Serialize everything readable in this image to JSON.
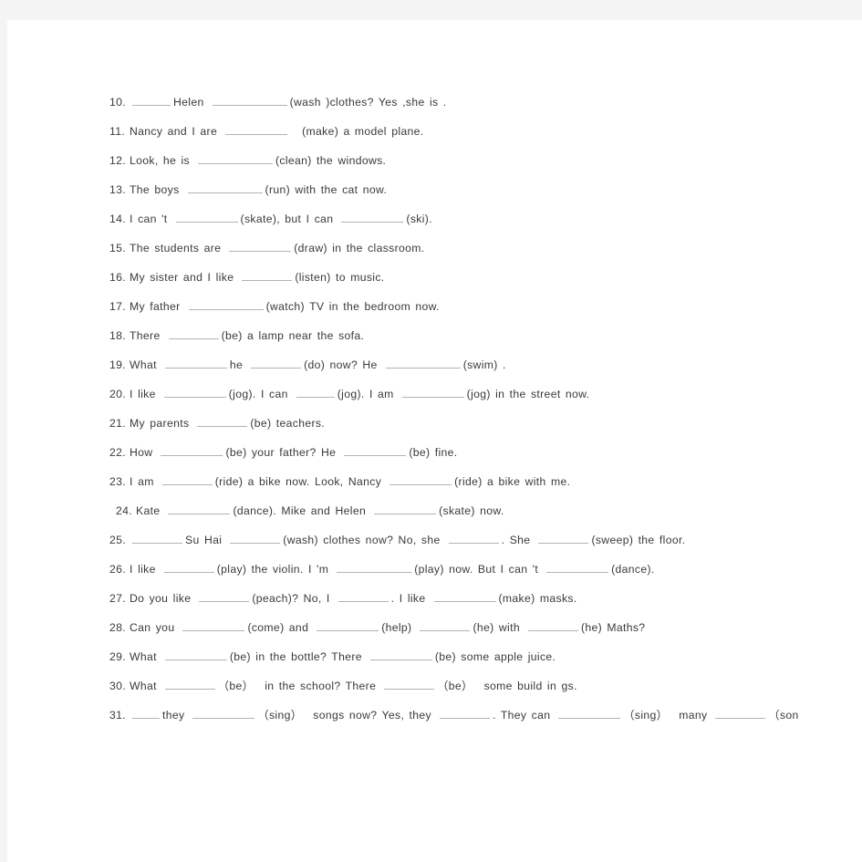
{
  "document": {
    "type": "english-grammar-worksheet",
    "page_background": "#f4f4f4",
    "paper_color": "#ffffff",
    "text_color": "#3a3a3a",
    "blank_rule_color": "#b3b3b3"
  },
  "exercises": [
    {
      "number": "10.",
      "indented": false,
      "segments": [
        {
          "type": "blank",
          "size": "s"
        },
        {
          "type": "text",
          "value": "Helen"
        },
        {
          "type": "blank",
          "size": "xl"
        },
        {
          "type": "text",
          "value": "(wash )clothes? Yes ,she is ."
        }
      ]
    },
    {
      "number": "11.",
      "indented": false,
      "segments": [
        {
          "type": "text",
          "value": "Nancy and I are"
        },
        {
          "type": "blank",
          "size": "l"
        },
        {
          "type": "gap"
        },
        {
          "type": "text",
          "value": "(make) a model plane."
        }
      ]
    },
    {
      "number": "12.",
      "indented": false,
      "segments": [
        {
          "type": "text",
          "value": "Look, he is"
        },
        {
          "type": "blank",
          "size": "xl"
        },
        {
          "type": "text",
          "value": "(clean) the windows."
        }
      ]
    },
    {
      "number": "13.",
      "indented": false,
      "segments": [
        {
          "type": "text",
          "value": "The boys"
        },
        {
          "type": "blank",
          "size": "xl"
        },
        {
          "type": "text",
          "value": "(run) with the cat now."
        }
      ]
    },
    {
      "number": "14.",
      "indented": false,
      "segments": [
        {
          "type": "text",
          "value": "I can 't"
        },
        {
          "type": "blank",
          "size": "l"
        },
        {
          "type": "text",
          "value": "(skate), but I can"
        },
        {
          "type": "blank",
          "size": "l"
        },
        {
          "type": "text",
          "value": "(ski)."
        }
      ]
    },
    {
      "number": "15.",
      "indented": false,
      "segments": [
        {
          "type": "text",
          "value": "The students are"
        },
        {
          "type": "blank",
          "size": "l"
        },
        {
          "type": "text",
          "value": "(draw) in the classroom."
        }
      ]
    },
    {
      "number": "16.",
      "indented": false,
      "segments": [
        {
          "type": "text",
          "value": "My sister and I like"
        },
        {
          "type": "blank",
          "size": "m"
        },
        {
          "type": "text",
          "value": "(listen) to music."
        }
      ]
    },
    {
      "number": "17.",
      "indented": false,
      "segments": [
        {
          "type": "text",
          "value": "My father"
        },
        {
          "type": "blank",
          "size": "xl"
        },
        {
          "type": "text",
          "value": "(watch) TV in the bedroom now."
        }
      ]
    },
    {
      "number": "18.",
      "indented": false,
      "segments": [
        {
          "type": "text",
          "value": "There"
        },
        {
          "type": "blank",
          "size": "m"
        },
        {
          "type": "text",
          "value": "(be) a lamp near the sofa."
        }
      ]
    },
    {
      "number": "19.",
      "indented": false,
      "segments": [
        {
          "type": "text",
          "value": "What"
        },
        {
          "type": "blank",
          "size": "l"
        },
        {
          "type": "text",
          "value": "he"
        },
        {
          "type": "blank",
          "size": "m"
        },
        {
          "type": "text",
          "value": "(do) now? He"
        },
        {
          "type": "blank",
          "size": "xl"
        },
        {
          "type": "text",
          "value": "(swim) ."
        }
      ]
    },
    {
      "number": "20.",
      "indented": false,
      "segments": [
        {
          "type": "text",
          "value": "I like"
        },
        {
          "type": "blank",
          "size": "l"
        },
        {
          "type": "text",
          "value": "(jog). I can"
        },
        {
          "type": "blank",
          "size": "s"
        },
        {
          "type": "text",
          "value": "(jog). I am"
        },
        {
          "type": "blank",
          "size": "l"
        },
        {
          "type": "text",
          "value": "(jog) in the street now."
        }
      ]
    },
    {
      "number": "21.",
      "indented": false,
      "segments": [
        {
          "type": "text",
          "value": "My parents"
        },
        {
          "type": "blank",
          "size": "m"
        },
        {
          "type": "text",
          "value": "(be) teachers."
        }
      ]
    },
    {
      "number": "22.",
      "indented": false,
      "segments": [
        {
          "type": "text",
          "value": "How"
        },
        {
          "type": "blank",
          "size": "l"
        },
        {
          "type": "text",
          "value": "(be) your father? He"
        },
        {
          "type": "blank",
          "size": "l"
        },
        {
          "type": "text",
          "value": "(be) fine."
        }
      ]
    },
    {
      "number": "23.",
      "indented": false,
      "segments": [
        {
          "type": "text",
          "value": "I am"
        },
        {
          "type": "blank",
          "size": "m"
        },
        {
          "type": "text",
          "value": "(ride) a bike now. Look, Nancy"
        },
        {
          "type": "blank",
          "size": "l"
        },
        {
          "type": "text",
          "value": "(ride) a bike with me."
        }
      ]
    },
    {
      "number": "24.",
      "indented": true,
      "segments": [
        {
          "type": "text",
          "value": "Kate"
        },
        {
          "type": "blank",
          "size": "l"
        },
        {
          "type": "text",
          "value": "(dance). Mike and Helen"
        },
        {
          "type": "blank",
          "size": "l"
        },
        {
          "type": "text",
          "value": "(skate) now."
        }
      ]
    },
    {
      "number": "25.",
      "indented": false,
      "segments": [
        {
          "type": "blank",
          "size": "m"
        },
        {
          "type": "text",
          "value": "Su Hai"
        },
        {
          "type": "blank",
          "size": "m"
        },
        {
          "type": "text",
          "value": "(wash) clothes now? No, she"
        },
        {
          "type": "blank",
          "size": "m"
        },
        {
          "type": "text",
          "value": ". She"
        },
        {
          "type": "blank",
          "size": "m"
        },
        {
          "type": "text",
          "value": "(sweep) the floor."
        }
      ]
    },
    {
      "number": "26.",
      "indented": false,
      "segments": [
        {
          "type": "text",
          "value": "I like"
        },
        {
          "type": "blank",
          "size": "m"
        },
        {
          "type": "text",
          "value": "(play) the violin. I 'm"
        },
        {
          "type": "blank",
          "size": "xl"
        },
        {
          "type": "text",
          "value": "(play) now. But I can 't"
        },
        {
          "type": "blank",
          "size": "l"
        },
        {
          "type": "text",
          "value": "(dance)."
        }
      ]
    },
    {
      "number": "27.",
      "indented": false,
      "segments": [
        {
          "type": "text",
          "value": "Do you like"
        },
        {
          "type": "blank",
          "size": "m"
        },
        {
          "type": "text",
          "value": "(peach)? No, I"
        },
        {
          "type": "blank",
          "size": "m"
        },
        {
          "type": "text",
          "value": ". I like"
        },
        {
          "type": "blank",
          "size": "l"
        },
        {
          "type": "text",
          "value": "(make) masks."
        }
      ]
    },
    {
      "number": "28.",
      "indented": false,
      "segments": [
        {
          "type": "text",
          "value": "Can you"
        },
        {
          "type": "blank",
          "size": "l"
        },
        {
          "type": "text",
          "value": "(come) and"
        },
        {
          "type": "blank",
          "size": "l"
        },
        {
          "type": "text",
          "value": "(help)"
        },
        {
          "type": "blank",
          "size": "m"
        },
        {
          "type": "text",
          "value": "(he) with"
        },
        {
          "type": "blank",
          "size": "m"
        },
        {
          "type": "text",
          "value": "(he) Maths?"
        }
      ]
    },
    {
      "number": "29.",
      "indented": false,
      "segments": [
        {
          "type": "text",
          "value": "What"
        },
        {
          "type": "blank",
          "size": "l"
        },
        {
          "type": "text",
          "value": "(be) in the bottle? There"
        },
        {
          "type": "blank",
          "size": "l"
        },
        {
          "type": "text",
          "value": "(be) some apple juice."
        }
      ]
    },
    {
      "number": "30.",
      "indented": false,
      "segments": [
        {
          "type": "text",
          "value": "What"
        },
        {
          "type": "blank",
          "size": "m"
        },
        {
          "type": "text",
          "value": "（be）"
        },
        {
          "type": "sp"
        },
        {
          "type": "text",
          "value": "in the school? There"
        },
        {
          "type": "blank",
          "size": "m"
        },
        {
          "type": "text",
          "value": "（be）"
        },
        {
          "type": "sp"
        },
        {
          "type": "text",
          "value": "some build in gs."
        }
      ]
    },
    {
      "number": "31.",
      "indented": false,
      "segments": [
        {
          "type": "blank",
          "size": "xs"
        },
        {
          "type": "text",
          "value": "they"
        },
        {
          "type": "blank",
          "size": "l"
        },
        {
          "type": "text",
          "value": "（sing）"
        },
        {
          "type": "sp"
        },
        {
          "type": "text",
          "value": "songs now? Yes, they"
        },
        {
          "type": "blank",
          "size": "m"
        },
        {
          "type": "text",
          "value": ". They can"
        },
        {
          "type": "blank",
          "size": "l"
        },
        {
          "type": "text",
          "value": "（sing）"
        },
        {
          "type": "sp"
        },
        {
          "type": "text",
          "value": "many"
        },
        {
          "type": "blank",
          "size": "m"
        },
        {
          "type": "text",
          "value": "（son"
        }
      ]
    }
  ]
}
